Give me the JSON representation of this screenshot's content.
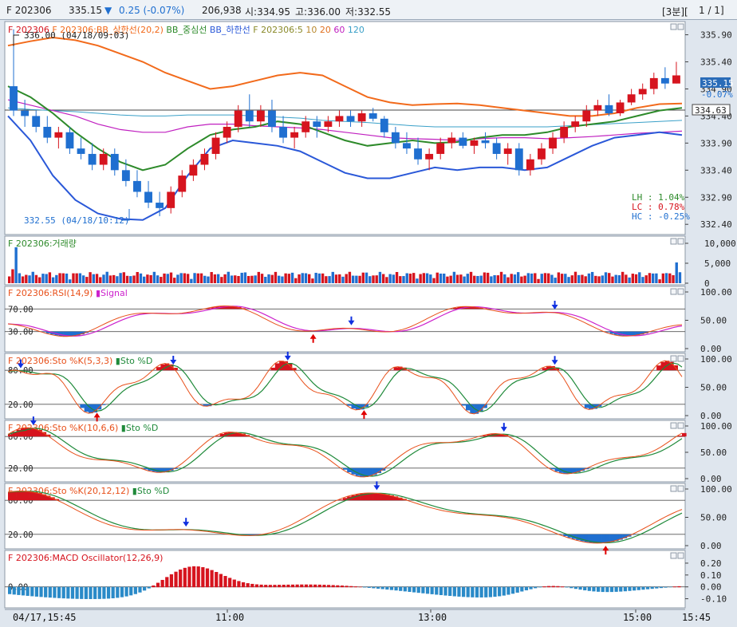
{
  "header": {
    "symbol": "F 202306",
    "price": "335.15",
    "change_arrow": "▼",
    "change": "0.25 (-0.07%)",
    "volume": "206,938",
    "open": "시:334.95",
    "high": "고:336.00",
    "low": "저:332.55",
    "interval": "[3분][",
    "page": "1 / 1]"
  },
  "colors": {
    "up": "#d6141e",
    "down": "#1f6fd0",
    "bb_upper": "#f26a1b",
    "bb_mid": "#2d8a2a",
    "bb_lower": "#2a58d8",
    "ma10": "#b8882c",
    "ma20": "#e07020",
    "ma60": "#c020c0",
    "ma120": "#3aa0c8",
    "rsi": "#e8501a",
    "signal": "#cc22cc",
    "stoK": "#e8501a",
    "stoD": "#1f8a3a",
    "macd_up": "#d6141e",
    "macd_down": "#2a8ac8"
  },
  "panels": {
    "price": {
      "legend": [
        {
          "text": "F 202306",
          "color": "#d6141e"
        },
        {
          "text": "F 202306:BB_상한선(20,2)",
          "color": "#f26a1b"
        },
        {
          "text": "BB_중심선",
          "color": "#2d8a2a"
        },
        {
          "text": "BB_하한선",
          "color": "#2a58d8"
        },
        {
          "text": "F 202306:5",
          "color": "#8a8a2a"
        },
        {
          "text": "10",
          "color": "#b8882c"
        },
        {
          "text": "20",
          "color": "#e07020"
        },
        {
          "text": "60",
          "color": "#c020c0"
        },
        {
          "text": "120",
          "color": "#3aa0c8"
        }
      ],
      "high_note": "336.00 (04/18/09:03)",
      "low_note": "332.55 (04/18/10:12)",
      "yticks": [
        "335.90",
        "335.40",
        "334.90",
        "334.40",
        "333.90",
        "333.40",
        "332.90",
        "332.40"
      ],
      "last_price_label": "335.15",
      "last_change_label": "-0.07%",
      "line_label": "334.63",
      "stats": [
        "LH :  1.04%",
        "LC :  0.78%",
        "HC : -0.25%"
      ]
    },
    "volume": {
      "title": "F 202306:거래량",
      "yticks": [
        "10,000",
        "5,000",
        "0"
      ]
    },
    "rsi": {
      "title": "F 202306:RSI(14,9)",
      "signal_label": "Signal",
      "levels": [
        "70.00",
        "30.00"
      ],
      "yticks": [
        "100.00",
        "50.00",
        "0.00"
      ]
    },
    "sto1": {
      "title": "F 202306:Sto %K(5,3,3)",
      "d_label": "Sto %D",
      "levels": [
        "80.00",
        "20.00"
      ],
      "yticks": [
        "100.00",
        "50.00",
        "0.00"
      ]
    },
    "sto2": {
      "title": "F 202306:Sto %K(10,6,6)",
      "d_label": "Sto %D",
      "levels": [
        "80.00",
        "20.00"
      ],
      "yticks": [
        "100.00",
        "50.00",
        "0.00"
      ]
    },
    "sto3": {
      "title": "F 202306:Sto %K(20,12,12)",
      "d_label": "Sto %D",
      "levels": [
        "80.00",
        "20.00"
      ],
      "yticks": [
        "100.00",
        "50.00",
        "0.00"
      ]
    },
    "macd": {
      "title": "F 202306:MACD Oscillator(12,26,9)",
      "level": "0.00",
      "yticks": [
        "0.20",
        "0.10",
        "0.00",
        "-0.10"
      ]
    }
  },
  "xaxis": {
    "labels": [
      "04/17,15:45",
      "11:00",
      "13:00",
      "15:00",
      "15:45"
    ]
  },
  "chart_data": {
    "type": "candlestick",
    "x_labels": [
      "04/17,15:45",
      "11:00",
      "13:00",
      "15:00",
      "15:45"
    ],
    "price": {
      "ylim": [
        332.3,
        336.1
      ],
      "high": 336.0,
      "low": 332.55,
      "last": 335.15,
      "ohlc": [
        [
          334.95,
          336.0,
          334.4,
          334.5
        ],
        [
          334.5,
          334.7,
          334.2,
          334.4
        ],
        [
          334.4,
          334.5,
          334.1,
          334.2
        ],
        [
          334.2,
          334.4,
          333.9,
          334.0
        ],
        [
          334.0,
          334.2,
          333.8,
          334.1
        ],
        [
          334.1,
          334.2,
          333.7,
          333.8
        ],
        [
          333.8,
          334.0,
          333.6,
          333.7
        ],
        [
          333.7,
          333.9,
          333.4,
          333.5
        ],
        [
          333.5,
          333.8,
          333.4,
          333.7
        ],
        [
          333.7,
          333.8,
          333.3,
          333.4
        ],
        [
          333.4,
          333.6,
          333.1,
          333.2
        ],
        [
          333.2,
          333.4,
          332.9,
          333.0
        ],
        [
          333.0,
          333.2,
          332.7,
          332.8
        ],
        [
          332.8,
          333.0,
          332.55,
          332.7
        ],
        [
          332.7,
          333.1,
          332.6,
          333.0
        ],
        [
          333.0,
          333.4,
          332.9,
          333.3
        ],
        [
          333.3,
          333.6,
          333.2,
          333.5
        ],
        [
          333.5,
          333.8,
          333.4,
          333.7
        ],
        [
          333.7,
          334.1,
          333.6,
          334.0
        ],
        [
          334.0,
          334.3,
          333.9,
          334.2
        ],
        [
          334.2,
          334.6,
          334.1,
          334.5
        ],
        [
          334.5,
          334.8,
          334.2,
          334.3
        ],
        [
          334.3,
          334.6,
          334.2,
          334.5
        ],
        [
          334.5,
          334.7,
          334.1,
          334.2
        ],
        [
          334.2,
          334.4,
          333.9,
          334.0
        ],
        [
          334.0,
          334.2,
          333.8,
          334.1
        ],
        [
          334.1,
          334.4,
          334.0,
          334.3
        ],
        [
          334.3,
          334.4,
          334.0,
          334.2
        ],
        [
          334.2,
          334.4,
          334.1,
          334.3
        ],
        [
          334.3,
          334.5,
          334.2,
          334.4
        ],
        [
          334.4,
          334.5,
          334.2,
          334.3
        ],
        [
          334.3,
          334.5,
          334.2,
          334.45
        ],
        [
          334.45,
          334.55,
          334.3,
          334.35
        ],
        [
          334.35,
          334.4,
          334.0,
          334.1
        ],
        [
          334.1,
          334.2,
          333.8,
          333.9
        ],
        [
          333.9,
          334.1,
          333.7,
          333.8
        ],
        [
          333.8,
          334.0,
          333.5,
          333.6
        ],
        [
          333.6,
          333.8,
          333.4,
          333.7
        ],
        [
          333.7,
          334.0,
          333.6,
          333.9
        ],
        [
          333.9,
          334.1,
          333.8,
          334.0
        ],
        [
          334.0,
          334.1,
          333.8,
          333.85
        ],
        [
          333.85,
          334.0,
          333.7,
          333.95
        ],
        [
          333.95,
          334.1,
          333.8,
          333.9
        ],
        [
          333.9,
          334.0,
          333.6,
          333.7
        ],
        [
          333.7,
          333.9,
          333.5,
          333.8
        ],
        [
          333.8,
          333.9,
          333.3,
          333.4
        ],
        [
          333.4,
          333.7,
          333.3,
          333.6
        ],
        [
          333.6,
          333.9,
          333.5,
          333.8
        ],
        [
          333.8,
          334.1,
          333.7,
          334.0
        ],
        [
          334.0,
          334.3,
          333.9,
          334.2
        ],
        [
          334.2,
          334.4,
          334.1,
          334.3
        ],
        [
          334.3,
          334.6,
          334.2,
          334.5
        ],
        [
          334.5,
          334.7,
          334.4,
          334.6
        ],
        [
          334.6,
          334.8,
          334.4,
          334.45
        ],
        [
          334.45,
          334.7,
          334.4,
          334.65
        ],
        [
          334.65,
          334.9,
          334.6,
          334.8
        ],
        [
          334.8,
          335.0,
          334.7,
          334.9
        ],
        [
          334.9,
          335.2,
          334.8,
          335.1
        ],
        [
          335.1,
          335.3,
          334.9,
          335.0
        ],
        [
          335.0,
          335.4,
          335.0,
          335.15
        ]
      ],
      "bb_upper": [
        335.7,
        335.78,
        335.85,
        335.8,
        335.7,
        335.55,
        335.4,
        335.2,
        335.05,
        334.9,
        334.95,
        335.05,
        335.15,
        335.2,
        335.15,
        334.95,
        334.75,
        334.65,
        334.6,
        334.62,
        334.63,
        334.6,
        334.55,
        334.5,
        334.45,
        334.4,
        334.4,
        334.45,
        334.55,
        334.62,
        334.63
      ],
      "bb_mid": [
        334.95,
        334.75,
        334.45,
        334.1,
        333.8,
        333.55,
        333.4,
        333.5,
        333.8,
        334.05,
        334.15,
        334.2,
        334.3,
        334.25,
        334.1,
        333.95,
        333.85,
        333.9,
        333.95,
        333.9,
        333.92,
        334.0,
        334.05,
        334.05,
        334.1,
        334.2,
        334.25,
        334.3,
        334.4,
        334.5,
        334.55
      ],
      "bb_lower": [
        334.4,
        333.95,
        333.3,
        332.85,
        332.6,
        332.5,
        332.48,
        332.7,
        333.3,
        333.8,
        333.95,
        333.9,
        333.85,
        333.75,
        333.55,
        333.35,
        333.25,
        333.25,
        333.35,
        333.45,
        333.4,
        333.45,
        333.45,
        333.4,
        333.45,
        333.65,
        333.85,
        334.0,
        334.05,
        334.1,
        334.05
      ],
      "ma60": [
        334.7,
        334.6,
        334.5,
        334.4,
        334.25,
        334.15,
        334.1,
        334.1,
        334.2,
        334.25,
        334.25,
        334.22,
        334.2,
        334.18,
        334.15,
        334.1,
        334.05,
        334.0,
        333.98,
        333.97,
        333.95,
        333.98,
        334.0,
        334.0,
        333.98,
        334.0,
        334.02,
        334.05,
        334.08,
        334.1,
        334.12
      ],
      "ma120": [
        334.55,
        334.52,
        334.5,
        334.48,
        334.45,
        334.42,
        334.4,
        334.4,
        334.42,
        334.42,
        334.42,
        334.4,
        334.38,
        334.36,
        334.32,
        334.3,
        334.28,
        334.25,
        334.22,
        334.2,
        334.2,
        334.2,
        334.2,
        334.2,
        334.2,
        334.22,
        334.24,
        334.26,
        334.28,
        334.3,
        334.32
      ]
    },
    "volume": {
      "ylim": [
        0,
        11000
      ]
    },
    "rsi": {
      "ylim": [
        0,
        100
      ],
      "levels": [
        70,
        30
      ],
      "period": 14,
      "signal": 9
    },
    "sto_5_3_3": {
      "ylim": [
        0,
        100
      ],
      "levels": [
        80,
        20
      ]
    },
    "sto_10_6_6": {
      "ylim": [
        0,
        100
      ],
      "levels": [
        80,
        20
      ]
    },
    "sto_20_12_12": {
      "ylim": [
        0,
        100
      ],
      "levels": [
        80,
        20
      ]
    },
    "macd_oscillator": {
      "ylim": [
        -0.15,
        0.24
      ],
      "params": [
        12,
        26,
        9
      ]
    }
  }
}
